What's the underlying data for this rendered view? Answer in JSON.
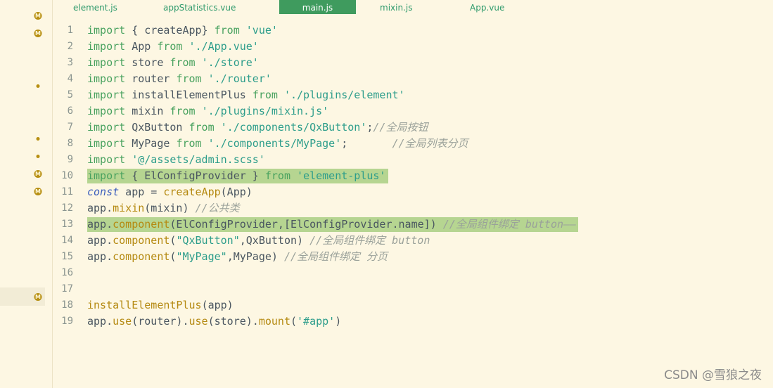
{
  "tabs": [
    {
      "label": "element.js",
      "active": false
    },
    {
      "label": "appStatistics.vue",
      "active": false
    },
    {
      "label": "main.js",
      "active": true
    },
    {
      "label": "mixin.js",
      "active": false
    },
    {
      "label": "App.vue",
      "active": false
    }
  ],
  "gutter_marks": [
    {
      "kind": "m",
      "symbol": "M"
    },
    {
      "kind": "m",
      "symbol": "M"
    },
    {
      "kind": "dot",
      "symbol": ""
    },
    {
      "kind": "dot",
      "symbol": ""
    },
    {
      "kind": "dot",
      "symbol": ""
    },
    {
      "kind": "m",
      "symbol": "M"
    },
    {
      "kind": "m",
      "symbol": "M"
    },
    {
      "kind": "m",
      "symbol": "M"
    }
  ],
  "colors": {
    "background": "#fdf7e3",
    "keyword": "#49a25f",
    "string": "#2d9d8b",
    "function": "#b58a12",
    "comment": "#9aa19a",
    "highlight": "#b6d591",
    "active_tab": "#3f9b5e"
  },
  "lines": [
    {
      "n": "1",
      "tokens": [
        [
          "kw",
          "import"
        ],
        [
          "p",
          " { createApp} "
        ],
        [
          "kw",
          "from"
        ],
        [
          "p",
          " "
        ],
        [
          "str",
          "'vue'"
        ]
      ]
    },
    {
      "n": "2",
      "tokens": [
        [
          "kw",
          "import"
        ],
        [
          "p",
          " App "
        ],
        [
          "kw",
          "from"
        ],
        [
          "p",
          " "
        ],
        [
          "str",
          "'./App.vue'"
        ]
      ]
    },
    {
      "n": "3",
      "tokens": [
        [
          "kw",
          "import"
        ],
        [
          "p",
          " store "
        ],
        [
          "kw",
          "from"
        ],
        [
          "p",
          " "
        ],
        [
          "str",
          "'./store'"
        ]
      ]
    },
    {
      "n": "4",
      "tokens": [
        [
          "kw",
          "import"
        ],
        [
          "p",
          " router "
        ],
        [
          "kw",
          "from"
        ],
        [
          "p",
          " "
        ],
        [
          "str",
          "'./router'"
        ]
      ]
    },
    {
      "n": "5",
      "tokens": [
        [
          "kw",
          "import"
        ],
        [
          "p",
          " installElementPlus "
        ],
        [
          "kw",
          "from"
        ],
        [
          "p",
          " "
        ],
        [
          "str",
          "'./plugins/element'"
        ]
      ]
    },
    {
      "n": "6",
      "tokens": [
        [
          "kw",
          "import"
        ],
        [
          "p",
          " mixin "
        ],
        [
          "kw",
          "from"
        ],
        [
          "p",
          " "
        ],
        [
          "str",
          "'./plugins/mixin.js'"
        ]
      ]
    },
    {
      "n": "7",
      "tokens": [
        [
          "kw",
          "import"
        ],
        [
          "p",
          " QxButton "
        ],
        [
          "kw",
          "from"
        ],
        [
          "p",
          " "
        ],
        [
          "str",
          "'./components/QxButton'"
        ],
        [
          "p",
          ";"
        ],
        [
          "cm",
          "//全局按钮"
        ]
      ]
    },
    {
      "n": "8",
      "tokens": [
        [
          "kw",
          "import"
        ],
        [
          "p",
          " MyPage "
        ],
        [
          "kw",
          "from"
        ],
        [
          "p",
          " "
        ],
        [
          "str",
          "'./components/MyPage'"
        ],
        [
          "p",
          ";       "
        ],
        [
          "cm",
          "//全局列表分页"
        ]
      ]
    },
    {
      "n": "9",
      "tokens": [
        [
          "kw",
          "import"
        ],
        [
          "p",
          " "
        ],
        [
          "str",
          "'@/assets/admin.scss'"
        ]
      ]
    },
    {
      "n": "10",
      "highlight": true,
      "tokens": [
        [
          "kw",
          "import"
        ],
        [
          "p",
          " { ElConfigProvider } "
        ],
        [
          "kw",
          "from"
        ],
        [
          "p",
          " "
        ],
        [
          "str",
          "'element-plus'"
        ]
      ]
    },
    {
      "n": "11",
      "tokens": [
        [
          "const",
          "const"
        ],
        [
          "p",
          " app = "
        ],
        [
          "fn",
          "createApp"
        ],
        [
          "p",
          "(App)"
        ]
      ]
    },
    {
      "n": "12",
      "tokens": [
        [
          "p",
          "app."
        ],
        [
          "fn",
          "mixin"
        ],
        [
          "p",
          "(mixin) "
        ],
        [
          "cm",
          "//公共类"
        ]
      ]
    },
    {
      "n": "13",
      "highlight": true,
      "tokens": [
        [
          "p",
          "app."
        ],
        [
          "fn",
          "component"
        ],
        [
          "p",
          "(ElConfigProvider,[ElConfigProvider.name]) "
        ],
        [
          "cm",
          "//全局组件绑定 button——"
        ]
      ]
    },
    {
      "n": "14",
      "tokens": [
        [
          "p",
          "app."
        ],
        [
          "fn",
          "component"
        ],
        [
          "p",
          "("
        ],
        [
          "str",
          "\"QxButton\""
        ],
        [
          "p",
          ",QxButton) "
        ],
        [
          "cm",
          "//全局组件绑定 button"
        ]
      ]
    },
    {
      "n": "15",
      "tokens": [
        [
          "p",
          "app."
        ],
        [
          "fn",
          "component"
        ],
        [
          "p",
          "("
        ],
        [
          "str",
          "\"MyPage\""
        ],
        [
          "p",
          ",MyPage) "
        ],
        [
          "cm",
          "//全局组件绑定 分页"
        ]
      ]
    },
    {
      "n": "16",
      "tokens": []
    },
    {
      "n": "17",
      "tokens": []
    },
    {
      "n": "18",
      "tokens": [
        [
          "fn",
          "installElementPlus"
        ],
        [
          "p",
          "(app)"
        ]
      ]
    },
    {
      "n": "19",
      "tokens": [
        [
          "p",
          "app."
        ],
        [
          "fn",
          "use"
        ],
        [
          "p",
          "(router)."
        ],
        [
          "fn",
          "use"
        ],
        [
          "p",
          "(store)."
        ],
        [
          "fn",
          "mount"
        ],
        [
          "p",
          "("
        ],
        [
          "str",
          "'#app'"
        ],
        [
          "p",
          ")"
        ]
      ]
    }
  ],
  "watermark": "CSDN @雪狼之夜"
}
